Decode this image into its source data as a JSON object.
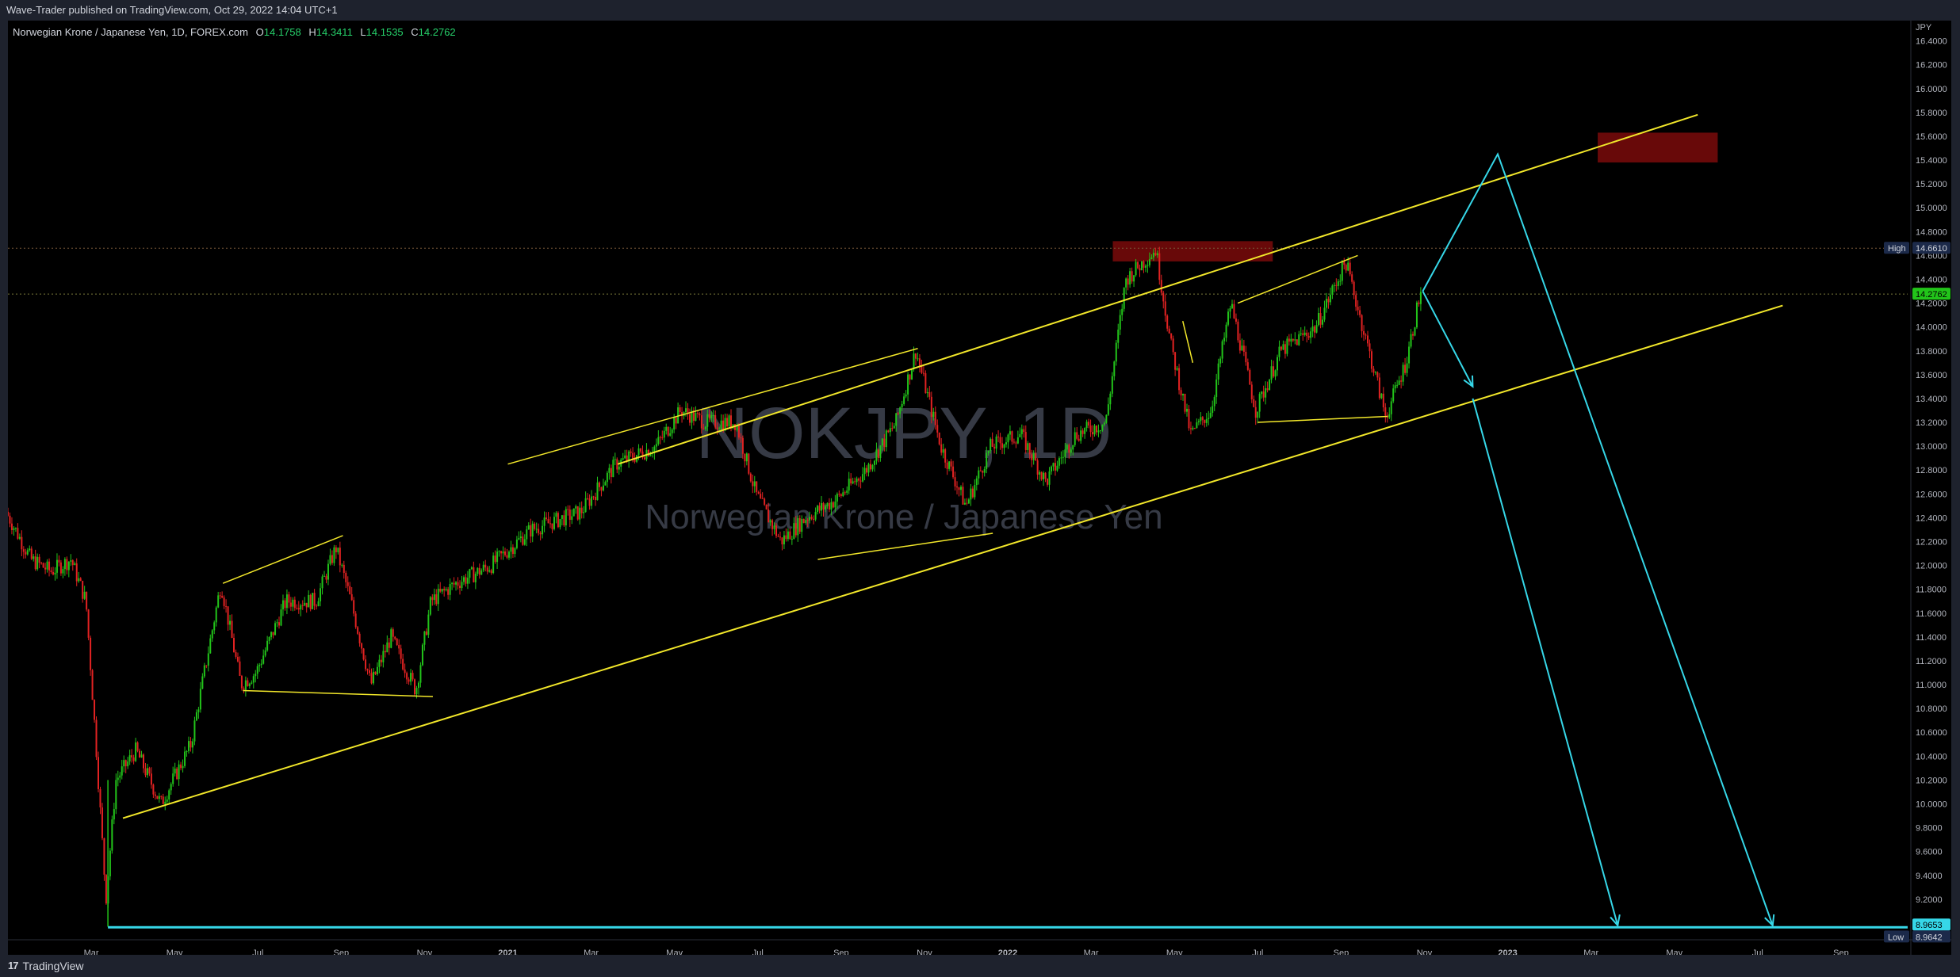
{
  "header": {
    "publisher_text": "Wave-Trader published on TradingView.com, Oct 29, 2022 14:04 UTC+1"
  },
  "legend": {
    "symbol_text": "Norwegian Krone / Japanese Yen, 1D, FOREX.com",
    "open_label": "O",
    "open_value": "14.1758",
    "high_label": "H",
    "high_value": "14.3411",
    "low_label": "L",
    "low_value": "14.1535",
    "close_label": "C",
    "close_value": "14.2762"
  },
  "watermark": {
    "ticker": "NOKJPY, 1D",
    "name": "Norwegian Krone / Japanese Yen"
  },
  "footer": {
    "brand": "TradingView",
    "logo_text": "17"
  },
  "tags": {
    "high_label": "High",
    "high_value": "14.6610",
    "last_value": "14.2762",
    "cyan_value": "8.9653",
    "low_label": "Low",
    "low_value": "8.9642"
  },
  "colors": {
    "background": "#000000",
    "up": "#22c41a",
    "down": "#e22222",
    "trendline": "#f2e72a",
    "projection": "#36d7e8",
    "zone": "#7a0a0a",
    "axis_text": "#b2b5be"
  },
  "chart_data": {
    "type": "candlestick",
    "symbol": "NOKJPY",
    "timeframe": "1D",
    "currency": "JPY",
    "ylim": [
      8.86,
      16.57
    ],
    "y_ticks": [
      "16.4000",
      "16.2000",
      "16.0000",
      "15.8000",
      "15.6000",
      "15.4000",
      "15.2000",
      "15.0000",
      "14.8000",
      "14.6000",
      "14.4000",
      "14.2000",
      "14.0000",
      "13.8000",
      "13.6000",
      "13.4000",
      "13.2000",
      "13.0000",
      "12.8000",
      "12.6000",
      "12.4000",
      "12.2000",
      "12.0000",
      "11.8000",
      "11.6000",
      "11.4000",
      "11.2000",
      "11.0000",
      "10.8000",
      "10.6000",
      "10.4000",
      "10.2000",
      "10.0000",
      "9.8000",
      "9.6000",
      "9.4000",
      "9.2000",
      "9.0000"
    ],
    "x_ticks": [
      "Mar",
      "May",
      "Jul",
      "Sep",
      "Nov",
      "2021",
      "Mar",
      "May",
      "Jul",
      "Sep",
      "Nov",
      "2022",
      "Mar",
      "May",
      "Jul",
      "Sep",
      "Nov",
      "2023",
      "Mar",
      "May",
      "Jul",
      "Sep"
    ],
    "x_start_year": 2020.0,
    "x_end_year": 2023.8,
    "price_path": [
      [
        2020.0,
        12.45
      ],
      [
        2020.05,
        12.05
      ],
      [
        2020.09,
        11.95
      ],
      [
        2020.13,
        12.05
      ],
      [
        2020.16,
        11.7
      ],
      [
        2020.18,
        10.5
      ],
      [
        2020.2,
        9.2
      ],
      [
        2020.22,
        10.2
      ],
      [
        2020.26,
        10.45
      ],
      [
        2020.31,
        10.0
      ],
      [
        2020.37,
        10.5
      ],
      [
        2020.43,
        11.85
      ],
      [
        2020.47,
        11.0
      ],
      [
        2020.5,
        11.1
      ],
      [
        2020.56,
        11.7
      ],
      [
        2020.62,
        11.7
      ],
      [
        2020.66,
        12.15
      ],
      [
        2020.69,
        11.7
      ],
      [
        2020.73,
        11.0
      ],
      [
        2020.77,
        11.4
      ],
      [
        2020.82,
        10.95
      ],
      [
        2020.85,
        11.7
      ],
      [
        2020.9,
        11.85
      ],
      [
        2020.97,
        12.0
      ],
      [
        2021.05,
        12.3
      ],
      [
        2021.15,
        12.45
      ],
      [
        2021.22,
        12.85
      ],
      [
        2021.3,
        13.0
      ],
      [
        2021.35,
        13.3
      ],
      [
        2021.4,
        13.2
      ],
      [
        2021.46,
        13.2
      ],
      [
        2021.5,
        12.6
      ],
      [
        2021.55,
        12.2
      ],
      [
        2021.6,
        12.4
      ],
      [
        2021.66,
        12.55
      ],
      [
        2021.72,
        12.8
      ],
      [
        2021.78,
        13.2
      ],
      [
        2021.82,
        13.8
      ],
      [
        2021.87,
        13.0
      ],
      [
        2021.92,
        12.5
      ],
      [
        2021.97,
        13.0
      ],
      [
        2022.03,
        13.1
      ],
      [
        2022.08,
        12.7
      ],
      [
        2022.14,
        13.1
      ],
      [
        2022.2,
        13.2
      ],
      [
        2022.24,
        14.4
      ],
      [
        2022.3,
        14.65
      ],
      [
        2022.33,
        13.85
      ],
      [
        2022.37,
        13.1
      ],
      [
        2022.41,
        13.3
      ],
      [
        2022.45,
        14.2
      ],
      [
        2022.5,
        13.3
      ],
      [
        2022.55,
        13.8
      ],
      [
        2022.62,
        14.0
      ],
      [
        2022.68,
        14.55
      ],
      [
        2022.72,
        13.9
      ],
      [
        2022.76,
        13.25
      ],
      [
        2022.8,
        13.7
      ],
      [
        2022.83,
        14.3
      ],
      [
        2022.83,
        14.28
      ]
    ],
    "channel": {
      "upper": [
        [
          2021.22,
          12.85
        ],
        [
          2023.38,
          15.78
        ]
      ],
      "lower": [
        [
          2020.23,
          9.88
        ],
        [
          2023.55,
          14.18
        ]
      ]
    },
    "price_lines": {
      "high": 14.661,
      "last": 14.2762,
      "low": 8.9642
    },
    "zones": [
      {
        "x": [
          2022.21,
          2022.53
        ],
        "y": [
          14.55,
          14.72
        ]
      },
      {
        "x": [
          2023.18,
          2023.42
        ],
        "y": [
          15.38,
          15.63
        ]
      }
    ],
    "projections": [
      [
        [
          2022.83,
          14.3
        ],
        [
          2022.93,
          13.5
        ]
      ],
      [
        [
          2022.83,
          14.3
        ],
        [
          2022.98,
          15.45
        ],
        [
          2023.53,
          8.98
        ]
      ],
      [
        [
          2022.93,
          13.4
        ],
        [
          2023.22,
          8.98
        ]
      ]
    ]
  }
}
